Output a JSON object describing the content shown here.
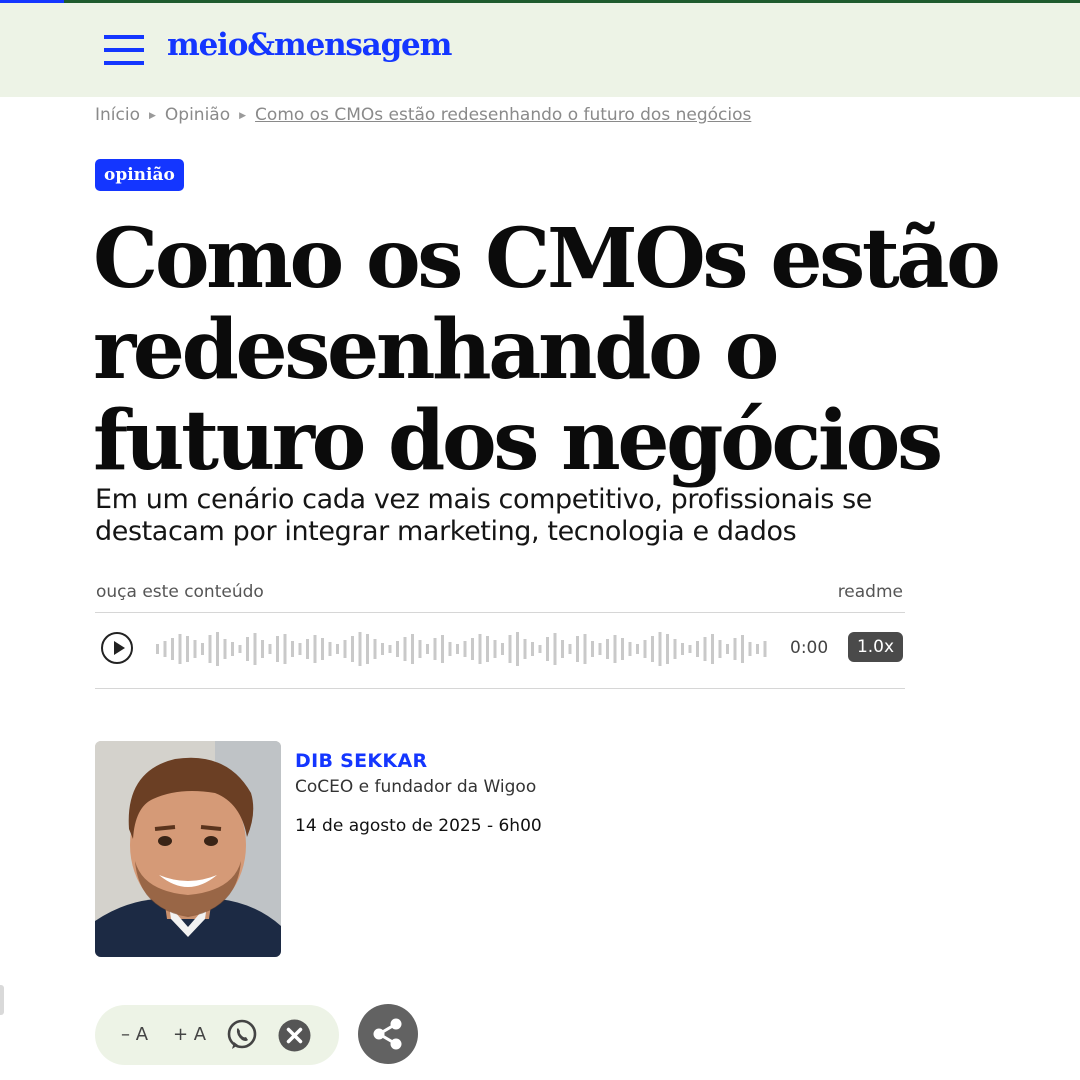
{
  "header": {
    "logo_text": "meio&mensagem",
    "menu_icon": "hamburger-menu-icon",
    "brand_color": "#1436ff",
    "bg_color": "#edf3e6"
  },
  "breadcrumb": {
    "items": [
      "Início",
      "Opinião",
      "Como os CMOs estão redesenhando o futuro dos negócios"
    ]
  },
  "article": {
    "category": "opinião",
    "headline": "Como os CMOs estão redesenhando o futuro dos negócios",
    "subtitle": "Em um cenário cada vez mais competitivo, profissionais se destacam por integrar marketing, tecnologia e dados"
  },
  "audio": {
    "label": "ouça este conteúdo",
    "brand": "readme",
    "time": "0:00",
    "speed": "1.0x",
    "progress": 0
  },
  "author": {
    "name": "DIB SEKKAR",
    "role": "CoCEO e fundador da Wigoo",
    "date": "14 de agosto de 2025 - 6h00"
  },
  "toolbar": {
    "decrease_font": "– A",
    "increase_font": "+ A",
    "icons": [
      "whatsapp-icon",
      "close-icon",
      "share-icon"
    ]
  }
}
